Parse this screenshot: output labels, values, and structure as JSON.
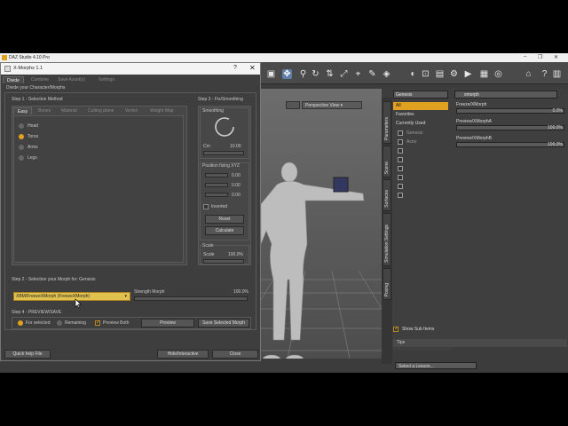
{
  "studio": {
    "title": "DAZ Studio 4.10 Pro",
    "win_min": "–",
    "win_max": "❐",
    "win_close": "✕"
  },
  "viewport": {
    "view_label": "Perspective View ▾"
  },
  "side_tabs": [
    "Parameters",
    "Scene",
    "Surfaces",
    "Simulation Settings",
    "Posing"
  ],
  "scene": {
    "filter": "Genesis",
    "items": [
      "All",
      "Favorites",
      "Currently Used"
    ],
    "rows": [
      "Genesis",
      "Actor",
      "",
      "",
      "",
      "",
      "",
      "",
      ""
    ],
    "show_sub": "Show Sub Items",
    "tips": "Tips",
    "lesson": "Select a Lesson..."
  },
  "params": {
    "search": "xmorph",
    "items": [
      {
        "label": "Freeze/XMorph",
        "value": "0.0%",
        "level": 0.0
      },
      {
        "label": "Preview/XMorphA",
        "value": "100.0%",
        "level": 1.0
      },
      {
        "label": "Preview/XMorphB",
        "value": "100.0%",
        "level": 1.0
      }
    ]
  },
  "dialog": {
    "title": "X-Morphs 1.1",
    "help": "?",
    "close": "✕",
    "tabs": [
      "Divide",
      "Combine",
      "Save Asset(s)",
      "Settings"
    ],
    "subtitle": "Divide your Character/Morphs",
    "step1": "Step 1 - Selection Method",
    "method_tabs": [
      "Easy",
      "Bones",
      "Material",
      "Cutting plane",
      "Vertex",
      "Weight Map"
    ],
    "methods": [
      "Head",
      "Torso",
      "Arms",
      "Legs"
    ],
    "selected_method": "Torso",
    "step3": "Step 3 - Fix/Smoothing",
    "smoothing": "Smoothing",
    "cm_label": "Cm",
    "cm_value": "10.00",
    "position_fixing": "Position fixing XYZ",
    "xyz": [
      "0.00",
      "0.00",
      "0.00"
    ],
    "inverted": "Inverted",
    "reset": "Reset",
    "calculate": "Calculate",
    "scale_group": "Scale",
    "scale_label": "Scale",
    "scale_value": "100.0%",
    "step2": "Step 2 - Selection your Morph for: Genesis",
    "morph_selected": "XBM/FreezeXMorph (FreezeXMorph)",
    "strength_label": "Strength Morph",
    "strength_value": "100.0%",
    "step4": "Step 4 - PREVIEW/SAVE",
    "for_selected": "For selected",
    "remaining": "Remaining",
    "preview_both": "Preview Both",
    "preview": "Preview",
    "save_selected": "Save Selected Morph",
    "quick_help": "Quick help File",
    "hide_interactive": "Hide/Interactive",
    "close_btn": "Close"
  },
  "colors": {
    "accent": "#e0a020",
    "panel": "#3e3e3e",
    "titlebar": "#f4f4f4"
  }
}
